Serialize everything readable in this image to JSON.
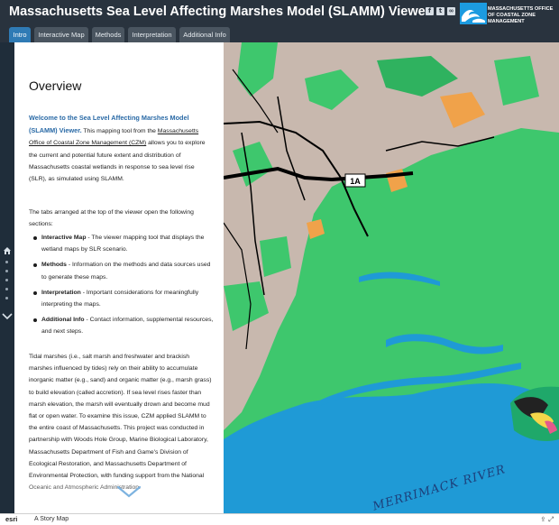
{
  "header": {
    "title": "Massachusetts Sea Level Affecting Marshes Model (SLAMM) Viewer",
    "social_icons": [
      "facebook-icon",
      "twitter-icon",
      "link-icon"
    ],
    "logo_text": "MASSACHUSETTS OFFICE OF COASTAL ZONE MANAGEMENT"
  },
  "tabs": [
    {
      "label": "Intro",
      "active": true
    },
    {
      "label": "Interactive Map",
      "active": false
    },
    {
      "label": "Methods",
      "active": false
    },
    {
      "label": "Interpretation",
      "active": false
    },
    {
      "label": "Additional Info",
      "active": false
    }
  ],
  "panel": {
    "heading": "Overview",
    "intro_lead": "Welcome to the Sea Level Affecting Marshes Model (SLAMM) Viewer.",
    "intro_pre": " This mapping tool from the ",
    "intro_link": "Massachusetts Office of Coastal Zone Management (CZM)",
    "intro_post": " allows you to explore the current and potential future extent and distribution of Massachusetts coastal wetlands in response to sea level rise (SLR), as simulated using SLAMM.",
    "tabs_intro": "The tabs arranged at the top of the viewer open the following sections:",
    "bullets": [
      {
        "term": "Interactive Map",
        "text": " - The viewer mapping tool that displays the wetland maps by SLR scenario."
      },
      {
        "term": "Methods",
        "text": " - Information on the methods and data sources used to generate these maps."
      },
      {
        "term": "Interpretation",
        "text": " - Important considerations for meaningfully interpreting the maps."
      },
      {
        "term": "Additional Info",
        "text": " - Contact information, supplemental resources, and next steps."
      }
    ],
    "body": "Tidal marshes (i.e., salt marsh and freshwater and brackish marshes influenced by tides) rely on their ability to accumulate inorganic matter (e.g., sand) and organic matter (e.g., marsh grass) to build elevation (called accretion). If sea level rises faster than marsh elevation, the marsh will eventually drown and become mud flat or open water. To examine this issue, CZM applied SLAMM to the entire coast of Massachusetts. This project was conducted in partnership with Woods Hole Group, Marine Biological Laboratory, Massachusetts Department of Fish and Game's Division of Ecological Restoration, and Massachusetts Department of Environmental Protection, with funding support from the National Oceanic and Atmospheric Administration."
  },
  "map": {
    "route_shield": "1A",
    "river_label": "MERRIMACK RIVER"
  },
  "footer": {
    "brand": "esri",
    "label": "A Story Map",
    "icons": [
      "share-icon",
      "fullscreen-icon"
    ]
  },
  "colors": {
    "header_bg": "#29333e",
    "active_tab": "#2f7bb5",
    "lead_text": "#2a6aa6",
    "ocean": "#1f9ad6",
    "marsh": "#3ec76d",
    "upland": "#c8b8ae"
  }
}
